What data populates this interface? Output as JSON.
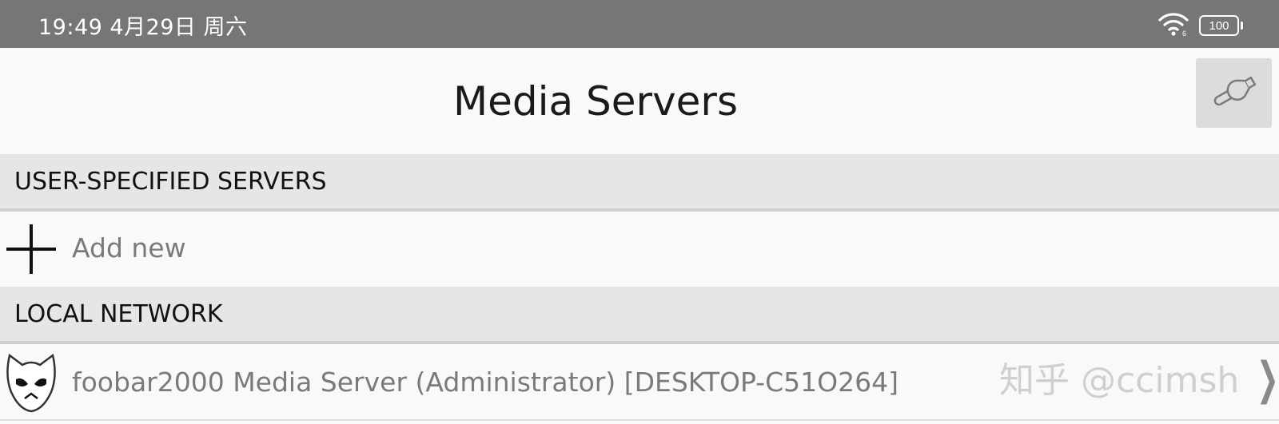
{
  "status_bar": {
    "time": "19:49 4月29日 周六",
    "wifi_icon": "wifi-icon",
    "battery_level": "100"
  },
  "header": {
    "title": "Media Servers",
    "settings_icon": "wrench-icon"
  },
  "sections": {
    "user_specified": {
      "label": "USER-SPECIFIED SERVERS",
      "add_label": "Add new",
      "add_icon": "plus-icon"
    },
    "local_network": {
      "label": "LOCAL NETWORK",
      "servers": [
        {
          "name": "foobar2000 Media Server (Administrator) [DESKTOP-C51O264]",
          "icon": "foobar2000-alien-icon",
          "chevron": "❯"
        }
      ]
    }
  },
  "watermark": "知乎 @ccimsh",
  "colors": {
    "status_bar": "#767676",
    "section_header": "#e6e6e6",
    "background": "#f9f9f9",
    "settings_button": "#dcdcdc"
  }
}
